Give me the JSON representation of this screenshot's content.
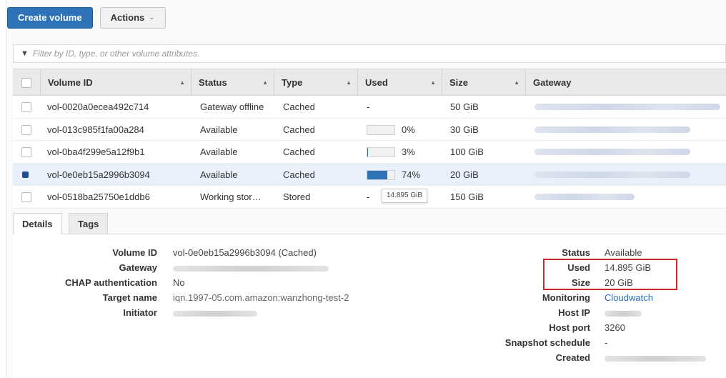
{
  "toolbar": {
    "create_label": "Create volume",
    "actions_label": "Actions"
  },
  "filter": {
    "placeholder": "Filter by ID, type, or other volume attributes."
  },
  "columns": [
    "Volume ID",
    "Status",
    "Type",
    "Used",
    "Size",
    "Gateway"
  ],
  "rows": [
    {
      "id": "vol-0020a0ecea492c714",
      "status": "Gateway offline",
      "type": "Cached",
      "used_text": "-",
      "used_fraction": null,
      "size": "50 GiB",
      "selected": false
    },
    {
      "id": "vol-013c985f1fa00a284",
      "status": "Available",
      "type": "Cached",
      "used_text": "0%",
      "used_fraction": 0.0,
      "size": "30 GiB",
      "selected": false
    },
    {
      "id": "vol-0ba4f299e5a12f9b1",
      "status": "Available",
      "type": "Cached",
      "used_text": "3%",
      "used_fraction": 0.03,
      "size": "100 GiB",
      "selected": false
    },
    {
      "id": "vol-0e0eb15a2996b3094",
      "status": "Available",
      "type": "Cached",
      "used_text": "74%",
      "used_fraction": 0.74,
      "size": "20 GiB",
      "selected": true
    },
    {
      "id": "vol-0518ba25750e1ddb6",
      "status": "Working stor…",
      "type": "Stored",
      "used_text": "-",
      "used_fraction": null,
      "size": "150 GiB",
      "selected": false
    }
  ],
  "tooltip": "14.895 GiB",
  "tabs": [
    "Details",
    "Tags"
  ],
  "details_left": {
    "volume_id_label": "Volume ID",
    "volume_id_value": "vol-0e0eb15a2996b3094 (Cached)",
    "gateway_label": "Gateway",
    "chap_label": "CHAP authentication",
    "chap_value": "No",
    "target_label": "Target name",
    "target_value": "iqn.1997-05.com.amazon:wanzhong-test-2",
    "initiator_label": "Initiator"
  },
  "details_right": {
    "status_label": "Status",
    "status_value": "Available",
    "used_label": "Used",
    "used_value": "14.895 GiB",
    "size_label": "Size",
    "size_value": "20 GiB",
    "monitoring_label": "Monitoring",
    "monitoring_value": "Cloudwatch",
    "hostip_label": "Host IP",
    "hostport_label": "Host port",
    "hostport_value": "3260",
    "snapshot_label": "Snapshot schedule",
    "snapshot_value": "-",
    "created_label": "Created"
  },
  "colors": {
    "primary": "#2e73b8",
    "selected_row": "#e8f1fb",
    "highlight_box": "#c62828",
    "link": "#2a6ebb"
  }
}
